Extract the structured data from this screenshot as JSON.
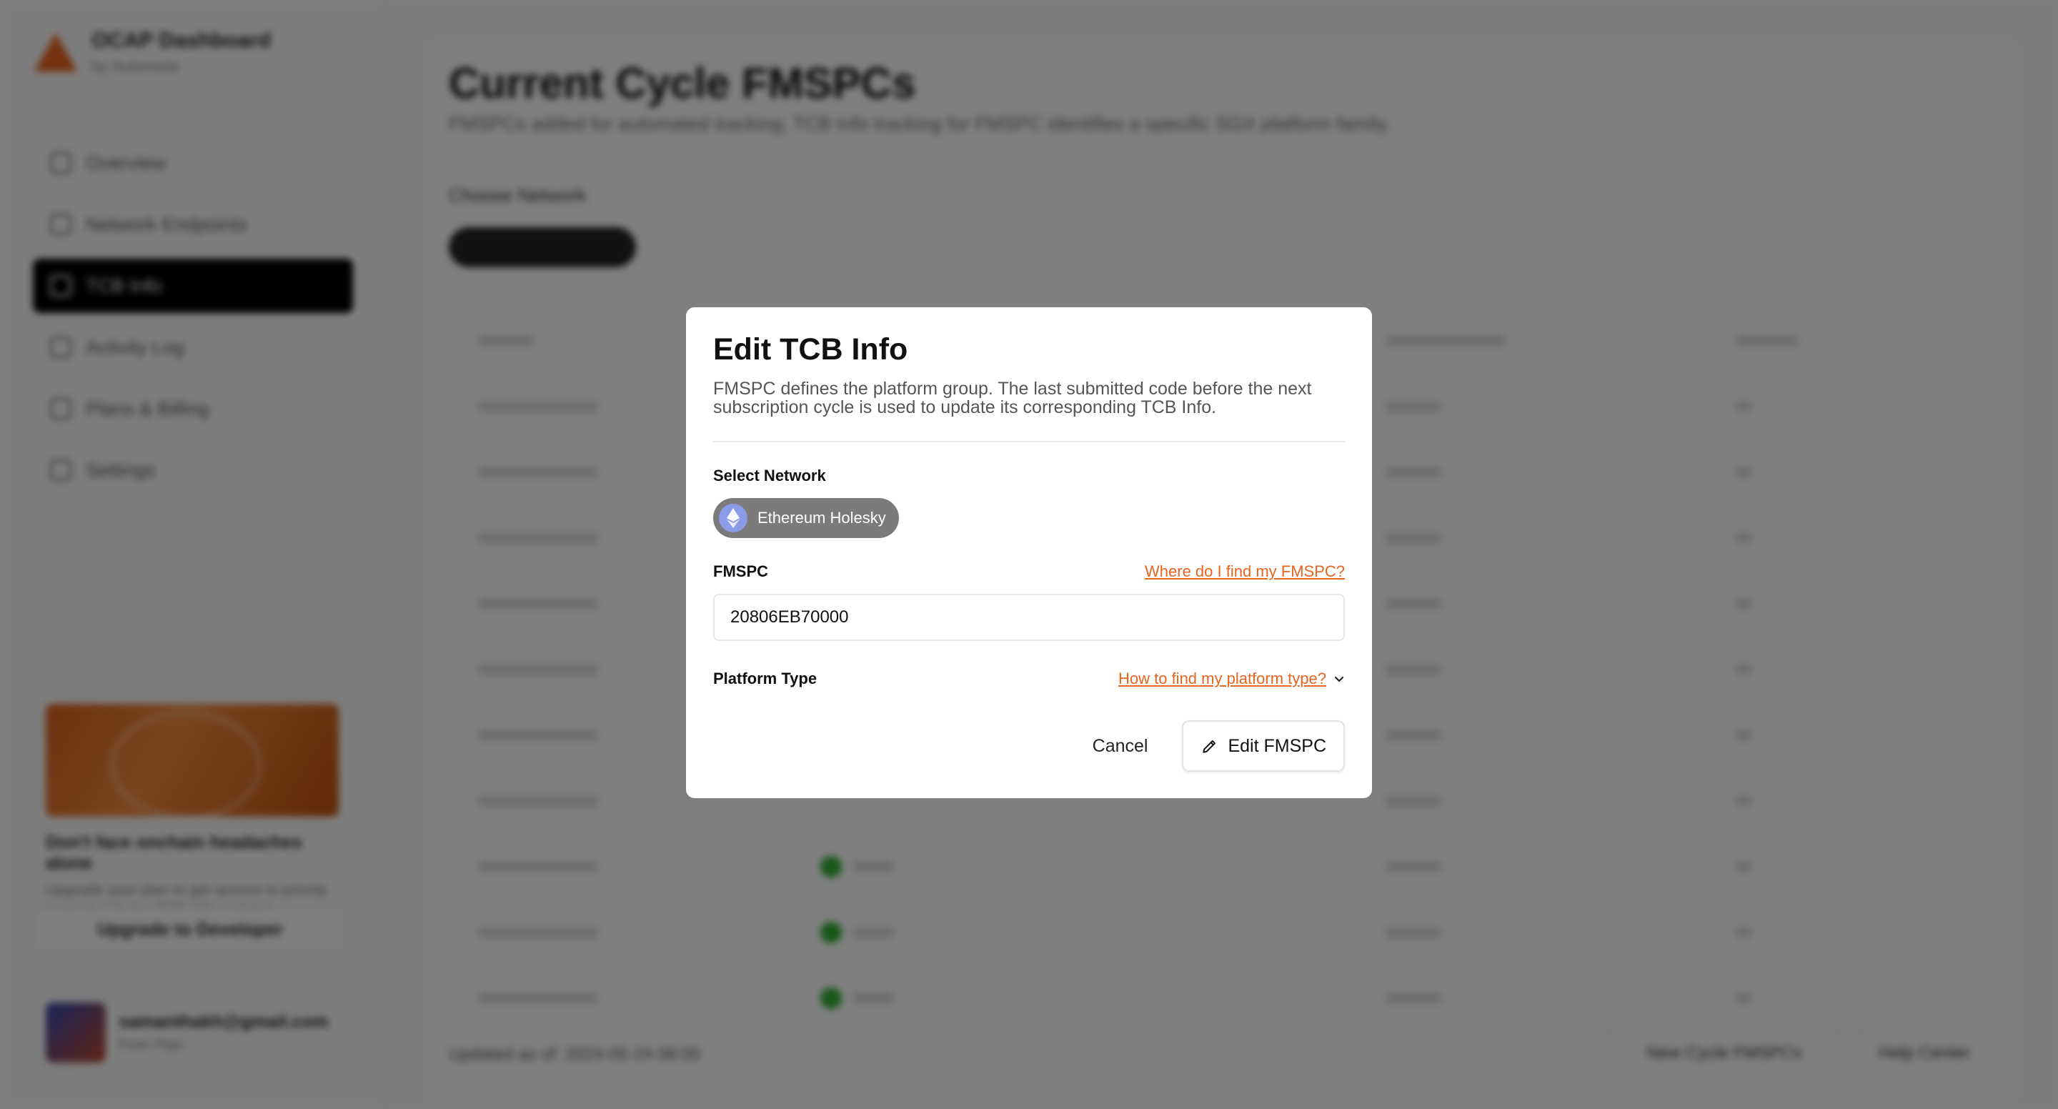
{
  "app": {
    "brand_title": "OCAP Dashboard",
    "brand_sub": "by Automata"
  },
  "sidebar": {
    "items": [
      {
        "label": "Overview"
      },
      {
        "label": "Network Endpoints"
      },
      {
        "label": "TCB Info"
      },
      {
        "label": "Activity Log"
      },
      {
        "label": "Plans & Billing"
      },
      {
        "label": "Settings"
      }
    ],
    "promo_title": "Don't face onchain headaches alone",
    "promo_text": "Upgrade your plan to get access to priority support & faster TCB Info updates.",
    "upgrade_label": "Upgrade to Developer",
    "user_name": "samanthakh@gmail.com",
    "user_plan": "Free Plan"
  },
  "page": {
    "title": "Current Cycle FMSPCs",
    "subtitle": "FMSPCs added for automated tracking; TCB Info tracking for FMSPC identifies a specific SGX platform family.",
    "network_label": "Choose Network",
    "footer_text": "Updated as of: 2024-05-24 08:00",
    "new_cycle_button": "New Cycle FMSPCs",
    "help_button": "Help Center"
  },
  "modal": {
    "title": "Edit TCB Info",
    "description": "FMSPC defines the platform group. The last submitted code before the next subscription cycle is used to update its corresponding TCB Info.",
    "select_network_label": "Select Network",
    "network_chip": "Ethereum Holesky",
    "fmspc_label": "FMSPC",
    "fmspc_help": "Where do I find my FMSPC?",
    "fmspc_value": "20806EB70000",
    "platform_label": "Platform Type",
    "platform_help": "How to find my platform type?",
    "cancel_label": "Cancel",
    "submit_label": "Edit FMSPC"
  },
  "colors": {
    "accent": "#e8641f",
    "overlay": "rgba(0,0,0,0.5)",
    "chip_bg": "#7b7b7b",
    "eth_circle": "#8b9be8"
  },
  "icons": {
    "network_chip": "ethereum-icon",
    "platform_help": "chevron-down-icon",
    "submit": "pencil-icon"
  }
}
